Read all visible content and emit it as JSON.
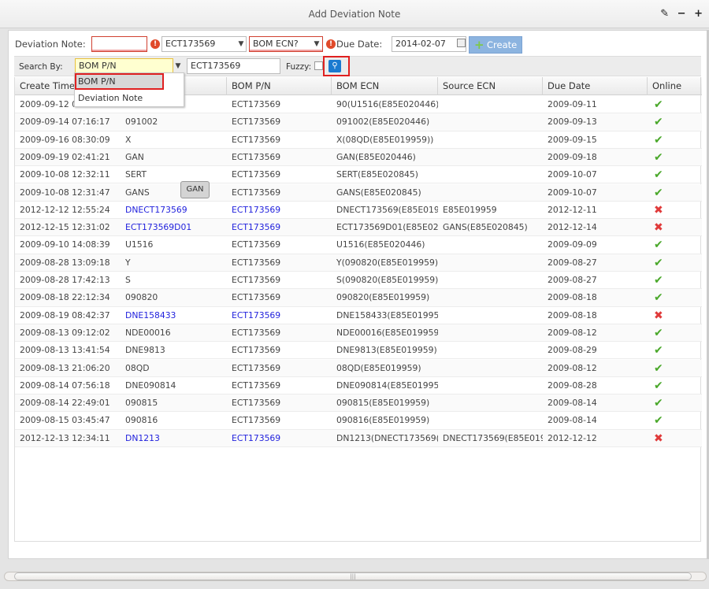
{
  "window": {
    "title": "Add Deviation Note",
    "wrench": "✎",
    "minimize": "−",
    "maximize": "+"
  },
  "form": {
    "deviation_note_label": "Deviation Note:",
    "deviation_note_value": "",
    "bom_pn_value": "ECT173569",
    "bom_ecn_value": "BOM ECN?",
    "due_date_label": "Due Date:",
    "due_date_value": "2014-02-07",
    "create_label": "Create"
  },
  "search": {
    "label": "Search By:",
    "by_value": "BOM P/N",
    "text_value": "ECT173569",
    "fuzzy_label": "Fuzzy:",
    "fuzzy_checked": false,
    "options": [
      "BOM P/N",
      "Deviation Note"
    ]
  },
  "tooltip": "GAN",
  "grid": {
    "columns": [
      "Create Time",
      "",
      "BOM P/N",
      "BOM ECN",
      "Source ECN",
      "Due Date",
      "Online"
    ],
    "rows": [
      [
        "2009-09-12 08:",
        "",
        "ECT173569",
        "90(U1516(E85E020446))",
        "",
        "2009-09-11",
        true,
        false
      ],
      [
        "2009-09-14 07:16:17",
        "091002",
        "ECT173569",
        "091002(E85E020446)",
        "",
        "2009-09-13",
        true,
        false
      ],
      [
        "2009-09-16 08:30:09",
        "X",
        "ECT173569",
        "X(08QD(E85E019959))",
        "",
        "2009-09-15",
        true,
        false
      ],
      [
        "2009-09-19 02:41:21",
        "GAN",
        "ECT173569",
        "GAN(E85E020446)",
        "",
        "2009-09-18",
        true,
        false
      ],
      [
        "2009-10-08 12:32:11",
        "SERT",
        "ECT173569",
        "SERT(E85E020845)",
        "",
        "2009-10-07",
        true,
        false
      ],
      [
        "2009-10-08 12:31:47",
        "GANS",
        "ECT173569",
        "GANS(E85E020845)",
        "",
        "2009-10-07",
        true,
        false
      ],
      [
        "2012-12-12 12:55:24",
        "DNECT173569",
        "ECT173569",
        "DNECT173569(E85E0199...",
        "E85E019959",
        "2012-12-11",
        false,
        true
      ],
      [
        "2012-12-15 12:31:02",
        "ECT173569D01",
        "ECT173569",
        "ECT173569D01(E85E020...",
        "GANS(E85E020845)",
        "2012-12-14",
        false,
        true
      ],
      [
        "2009-09-10 14:08:39",
        "U1516",
        "ECT173569",
        "U1516(E85E020446)",
        "",
        "2009-09-09",
        true,
        false
      ],
      [
        "2009-08-28 13:09:18",
        "Y",
        "ECT173569",
        "Y(090820(E85E019959))",
        "",
        "2009-08-27",
        true,
        false
      ],
      [
        "2009-08-28 17:42:13",
        "S",
        "ECT173569",
        "S(090820(E85E019959))",
        "",
        "2009-08-27",
        true,
        false
      ],
      [
        "2009-08-18 22:12:34",
        "090820",
        "ECT173569",
        "090820(E85E019959)",
        "",
        "2009-08-18",
        true,
        false
      ],
      [
        "2009-08-19 08:42:37",
        "DNE158433",
        "ECT173569",
        "DNE158433(E85E019959)",
        "",
        "2009-08-18",
        false,
        true
      ],
      [
        "2009-08-13 09:12:02",
        "NDE00016",
        "ECT173569",
        "NDE00016(E85E019959)",
        "",
        "2009-08-12",
        true,
        false
      ],
      [
        "2009-08-13 13:41:54",
        "DNE9813",
        "ECT173569",
        "DNE9813(E85E019959)",
        "",
        "2009-08-29",
        true,
        false
      ],
      [
        "2009-08-13 21:06:20",
        "08QD",
        "ECT173569",
        "08QD(E85E019959)",
        "",
        "2009-08-12",
        true,
        false
      ],
      [
        "2009-08-14 07:56:18",
        "DNE090814",
        "ECT173569",
        "DNE090814(E85E019959)",
        "",
        "2009-08-28",
        true,
        false
      ],
      [
        "2009-08-14 22:49:01",
        "090815",
        "ECT173569",
        "090815(E85E019959)",
        "",
        "2009-08-14",
        true,
        false
      ],
      [
        "2009-08-15 03:45:47",
        "090816",
        "ECT173569",
        "090816(E85E019959)",
        "",
        "2009-08-14",
        true,
        false
      ],
      [
        "2012-12-13 12:34:11",
        "DN1213",
        "ECT173569",
        "DN1213(DNECT173569(...",
        "DNECT173569(E85E0199...",
        "2012-12-12",
        false,
        true
      ]
    ]
  },
  "colors": {
    "link": "#2222dd",
    "online": "#4aa82a",
    "offline": "#e03a3a",
    "invalid": "#d04030",
    "create": "#8cb4e0"
  }
}
